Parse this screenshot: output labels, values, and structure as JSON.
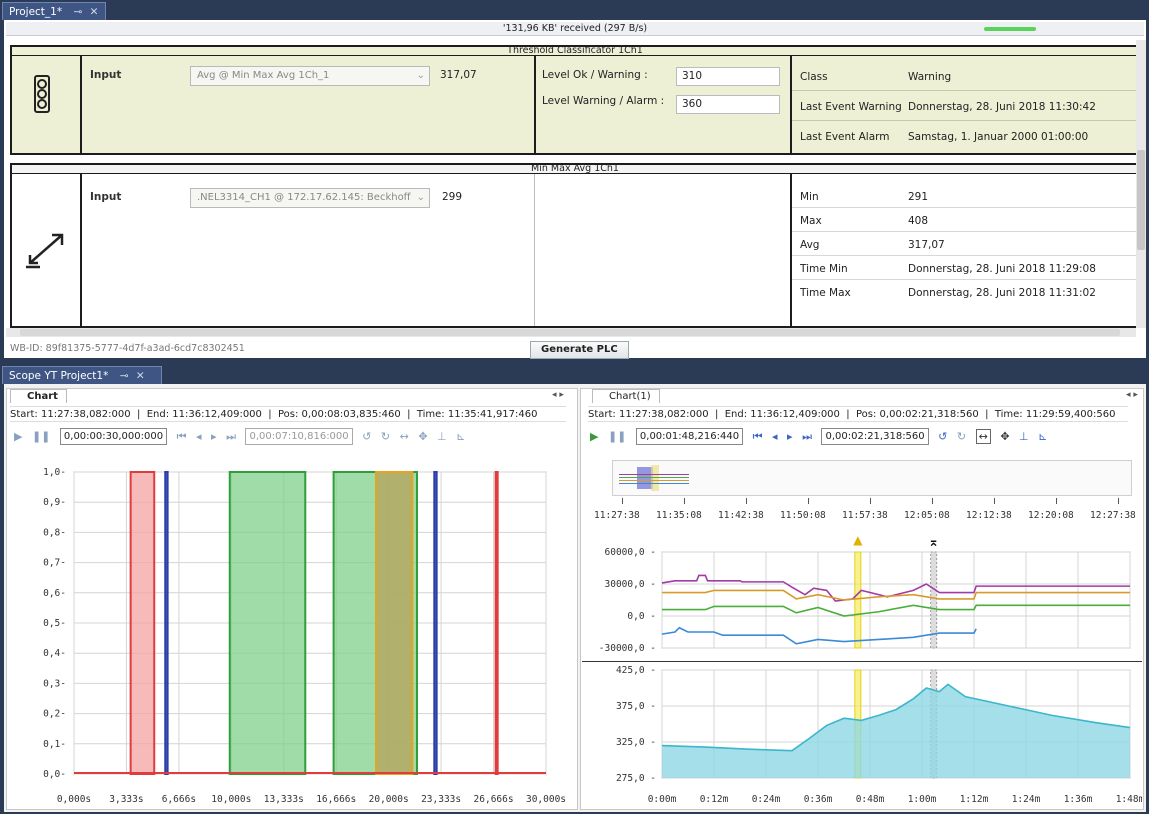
{
  "top_tab": {
    "title": "Project_1*"
  },
  "status": {
    "received": "'131,96 KB' received (297 B/s)"
  },
  "threshold": {
    "title": "Threshold Classificator 1Ch1",
    "input_label": "Input",
    "input_value": "Avg @ Min Max Avg 1Ch_1",
    "input_number": "317,07",
    "level_ok_label": "Level Ok / Warning :",
    "level_ok_value": "310",
    "level_warn_label": "Level Warning / Alarm :",
    "level_warn_value": "360",
    "props": [
      {
        "key": "Class",
        "value": "Warning"
      },
      {
        "key": "Last Event Warning",
        "value": "Donnerstag, 28. Juni 2018 11:30:42"
      },
      {
        "key": "Last Event Alarm",
        "value": "Samstag, 1. Januar 2000 01:00:00"
      }
    ]
  },
  "minmax": {
    "title": "Min Max Avg 1Ch1",
    "input_label": "Input",
    "input_value": ".NEL3314_CH1 @ 172.17.62.145: Beckhoff",
    "input_number": "299",
    "props": [
      {
        "key": "Min",
        "value": "291"
      },
      {
        "key": "Max",
        "value": "408"
      },
      {
        "key": "Avg",
        "value": "317,07"
      },
      {
        "key": "Time Min",
        "value": "Donnerstag, 28. Juni 2018 11:29:08"
      },
      {
        "key": "Time Max",
        "value": "Donnerstag, 28. Juni 2018 11:31:02"
      }
    ]
  },
  "wb_id": "WB-ID: 89f81375-5777-4d7f-a3ad-6cd7c8302451",
  "generate_button": "Generate PLC",
  "scope_tab": {
    "title": "Scope YT Project1*"
  },
  "left_chart": {
    "tab": "Chart",
    "start": "Start: 11:27:38,082:000",
    "end": "End: 11:36:12,409:000",
    "pos": "Pos: 0,00:08:03,835:460",
    "time": "Time: 11:35:41,917:460",
    "window_box": "0,00:00:30,000:000",
    "pos_box": "0,00:07:10,816:000"
  },
  "right_chart": {
    "tab": "Chart(1)",
    "start": "Start: 11:27:38,082:000",
    "end": "End: 11:36:12,409:000",
    "pos": "Pos: 0,00:02:21,318:560",
    "time": "Time: 11:29:59,400:560",
    "window_box": "0,00:01:48,216:440",
    "pos_box": "0,00:02:21,318:560"
  },
  "overview_ticks": [
    "11:27:38",
    "11:35:08",
    "11:42:38",
    "11:50:08",
    "11:57:38",
    "12:05:08",
    "12:12:38",
    "12:20:08",
    "12:27:38"
  ],
  "chart_data": [
    {
      "type": "area",
      "name": "digital-bands",
      "x_ticks": [
        "0,000s",
        "3,333s",
        "6,666s",
        "10,000s",
        "13,333s",
        "16,666s",
        "20,000s",
        "23,333s",
        "26,666s",
        "30,000s"
      ],
      "y_ticks": [
        "0,0",
        "0,1",
        "0,2",
        "0,3",
        "0,4",
        "0,5",
        "0,6",
        "0,7",
        "0,8",
        "0,9",
        "1,0"
      ],
      "xlim": [
        0,
        30
      ],
      "ylim": [
        0,
        1
      ],
      "series": [
        {
          "color": "#e03c3c",
          "fill": "#f4a3a3",
          "intervals": [
            [
              3.6,
              5.1
            ],
            [
              26.8,
              26.9
            ]
          ]
        },
        {
          "color": "#2c3fa8",
          "fill": "#2c3fa8",
          "intervals": [
            [
              5.8,
              5.95
            ],
            [
              22.9,
              23.05
            ]
          ]
        },
        {
          "color": "#2f9e3a",
          "fill": "#7fd089",
          "intervals": [
            [
              9.9,
              14.7
            ],
            [
              16.5,
              21.8
            ]
          ]
        },
        {
          "color": "#e8a21c",
          "fill": "#b8a25a",
          "intervals": [
            [
              19.2,
              21.5
            ]
          ]
        }
      ]
    },
    {
      "type": "line",
      "name": "multi-channel",
      "x_ticks": [
        "0:00m",
        "0:12m",
        "0:24m",
        "0:36m",
        "0:48m",
        "1:00m",
        "1:12m",
        "1:24m",
        "1:36m",
        "1:48m"
      ],
      "y_ticks": [
        "60000,0",
        "30000,0",
        "0,0",
        "-30000,0"
      ],
      "xlim": [
        0,
        108
      ],
      "ylim": [
        -30000,
        60000
      ],
      "series": [
        {
          "color": "#a43aa8",
          "values": [
            [
              0,
              31000
            ],
            [
              3,
              33000
            ],
            [
              8,
              33000
            ],
            [
              8.5,
              38000
            ],
            [
              10,
              38000
            ],
            [
              10.5,
              33000
            ],
            [
              18,
              33000
            ],
            [
              18.5,
              32000
            ],
            [
              28,
              32000
            ],
            [
              30,
              27000
            ],
            [
              33,
              20000
            ],
            [
              35,
              26000
            ],
            [
              38,
              24000
            ],
            [
              40,
              14000
            ],
            [
              44,
              16000
            ],
            [
              46,
              24000
            ],
            [
              52,
              18000
            ],
            [
              58,
              24000
            ],
            [
              61,
              30000
            ],
            [
              64,
              22000
            ],
            [
              72,
              22000
            ],
            [
              72.5,
              28000
            ],
            [
              108,
              28000
            ]
          ]
        },
        {
          "color": "#d89a2a",
          "values": [
            [
              0,
              22000
            ],
            [
              10,
              22000
            ],
            [
              12,
              24000
            ],
            [
              28,
              24000
            ],
            [
              31,
              16000
            ],
            [
              36,
              20000
            ],
            [
              42,
              15000
            ],
            [
              50,
              18000
            ],
            [
              58,
              20000
            ],
            [
              64,
              16000
            ],
            [
              72,
              16000
            ],
            [
              72.5,
              22000
            ],
            [
              108,
              22000
            ]
          ]
        },
        {
          "color": "#4bae3a",
          "values": [
            [
              0,
              6000
            ],
            [
              10,
              6000
            ],
            [
              12,
              9000
            ],
            [
              28,
              9000
            ],
            [
              31,
              3000
            ],
            [
              36,
              8000
            ],
            [
              42,
              0
            ],
            [
              50,
              4000
            ],
            [
              58,
              10000
            ],
            [
              64,
              6000
            ],
            [
              72,
              6000
            ],
            [
              72.5,
              10000
            ],
            [
              108,
              10000
            ]
          ]
        },
        {
          "color": "#3a8ad8",
          "values": [
            [
              0,
              -17000
            ],
            [
              3,
              -15000
            ],
            [
              4,
              -11000
            ],
            [
              6,
              -15000
            ],
            [
              12,
              -15000
            ],
            [
              14,
              -18000
            ],
            [
              28,
              -18000
            ],
            [
              31,
              -26000
            ],
            [
              36,
              -22000
            ],
            [
              42,
              -24000
            ],
            [
              50,
              -22000
            ],
            [
              58,
              -20000
            ],
            [
              64,
              -16000
            ],
            [
              72,
              -16000
            ],
            [
              72.5,
              -12000
            ]
          ]
        }
      ]
    },
    {
      "type": "area",
      "name": "single-channel",
      "x_ticks": [
        "0:00m",
        "0:12m",
        "0:24m",
        "0:36m",
        "0:48m",
        "1:00m",
        "1:12m",
        "1:24m",
        "1:36m",
        "1:48m"
      ],
      "y_ticks": [
        "425,0",
        "375,0",
        "325,0",
        "275,0"
      ],
      "xlim": [
        0,
        108
      ],
      "ylim": [
        275,
        425
      ],
      "series": [
        {
          "color": "#3bb6cc",
          "fill": "#8fd7e3",
          "values": [
            [
              0,
              320
            ],
            [
              10,
              318
            ],
            [
              20,
              315
            ],
            [
              30,
              313
            ],
            [
              34,
              330
            ],
            [
              38,
              348
            ],
            [
              42,
              358
            ],
            [
              46,
              355
            ],
            [
              50,
              362
            ],
            [
              54,
              370
            ],
            [
              58,
              385
            ],
            [
              61,
              400
            ],
            [
              64,
              395
            ],
            [
              66,
              405
            ],
            [
              70,
              388
            ],
            [
              80,
              375
            ],
            [
              90,
              362
            ],
            [
              100,
              352
            ],
            [
              108,
              345
            ]
          ]
        }
      ]
    }
  ]
}
